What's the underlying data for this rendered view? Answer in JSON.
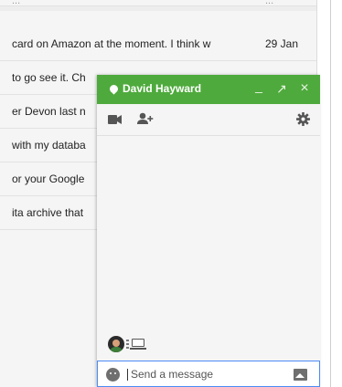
{
  "inbox": {
    "rows": [
      {
        "snippet": "...",
        "date": "...",
        "partial": true
      },
      {
        "snippet": "card on Amazon at the moment. I think w",
        "date": "29 Jan"
      },
      {
        "snippet": "to go see it. Ch",
        "date": ""
      },
      {
        "snippet": "er Devon last n",
        "date": ""
      },
      {
        "snippet": "with my databa",
        "date": ""
      },
      {
        "snippet": "or your Google",
        "date": ""
      },
      {
        "snippet": "ita archive that",
        "date": ""
      }
    ]
  },
  "chat": {
    "contact_name": "David Hayward",
    "header_color": "#4eaa3c",
    "presence_status": "online",
    "buttons": {
      "minimize": "_",
      "popout": "↗",
      "close": "×"
    },
    "toolbar": {
      "video_icon": "video-camera-icon",
      "add_person_icon": "add-person-icon",
      "settings_icon": "gear-icon"
    },
    "participant_device": "laptop-icon",
    "composer": {
      "placeholder": "Send a message",
      "value": "",
      "emoji_icon": "emoji-icon",
      "photo_icon": "photo-icon",
      "focus_color": "#4c8bf5"
    }
  }
}
